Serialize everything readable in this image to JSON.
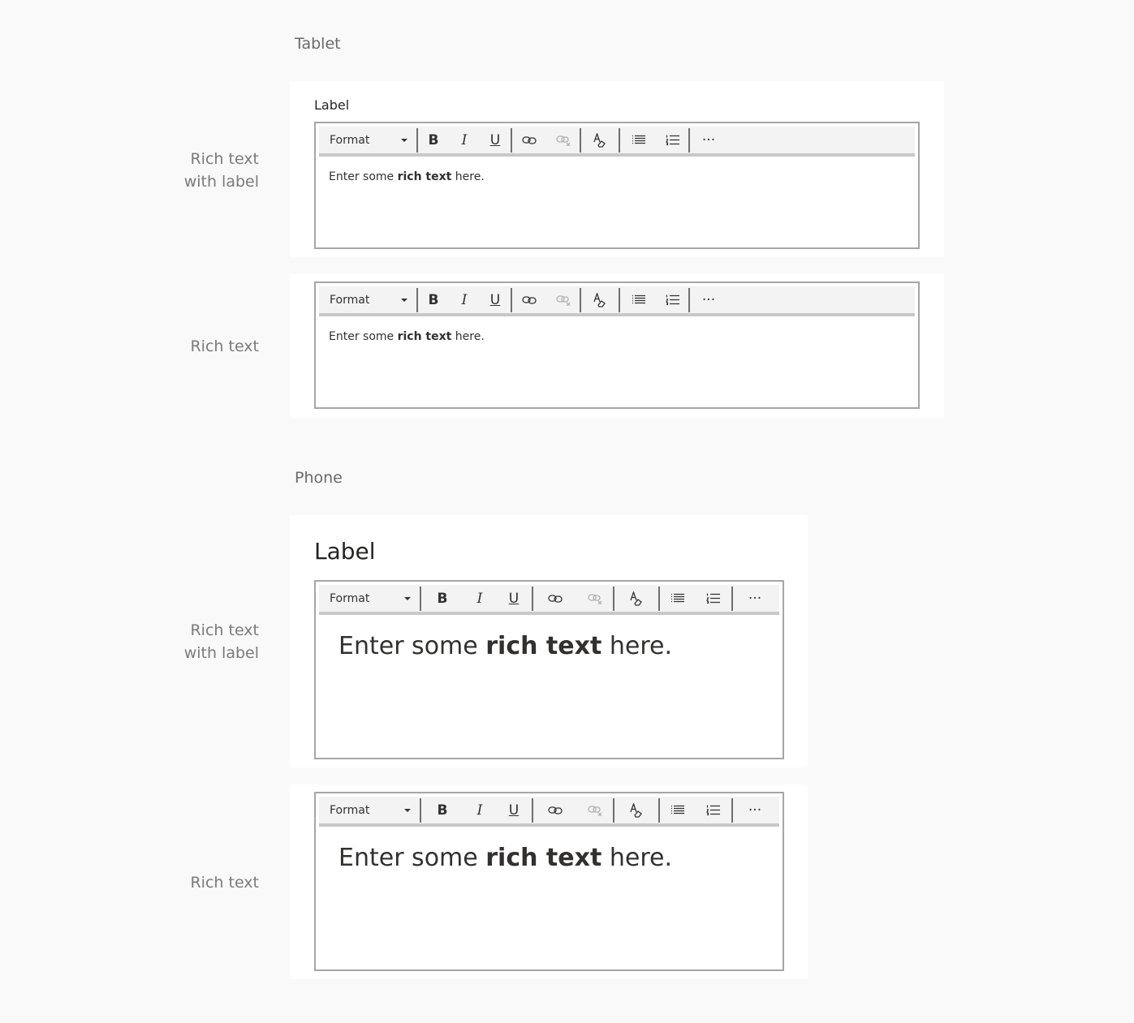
{
  "sections": {
    "tablet": "Tablet",
    "phone": "Phone"
  },
  "row_labels": {
    "rich_text_with_label": "Rich text\nwith label",
    "rich_text": "Rich text"
  },
  "field": {
    "label": "Label"
  },
  "toolbar": {
    "format": "Format",
    "bold": "B",
    "italic": "I",
    "underline": "U",
    "more": "···",
    "icons": [
      "chevron-down-icon",
      "bold-icon",
      "italic-icon",
      "underline-icon",
      "link-icon",
      "unlink-icon",
      "clear-formatting-icon",
      "bulleted-list-icon",
      "numbered-list-icon",
      "more-icon"
    ]
  },
  "content": {
    "before": "Enter some ",
    "bold": "rich text",
    "after": " here."
  },
  "colors": {
    "page_bg": "#f9f9f9",
    "card_bg": "#ffffff",
    "toolbar_bg": "#f3f3f3",
    "editor_border": "#a6a6a6",
    "disabled_icon": "#b0b0b0"
  }
}
